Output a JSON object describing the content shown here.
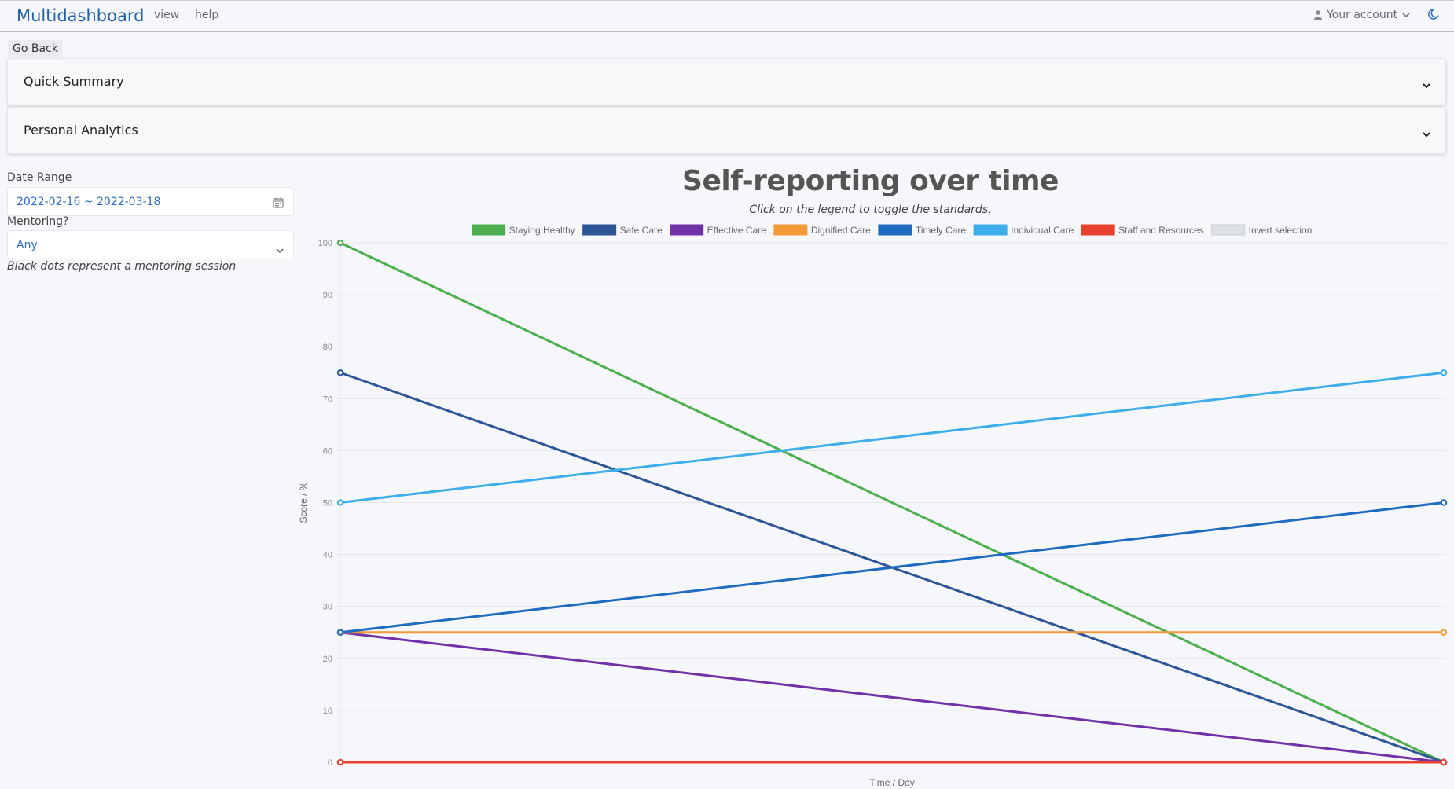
{
  "header": {
    "brand": "Multidashboard",
    "nav": [
      "view",
      "help"
    ],
    "account_label": "Your account"
  },
  "go_back_label": "Go Back",
  "panels": [
    {
      "title": "Quick Summary"
    },
    {
      "title": "Personal Analytics"
    }
  ],
  "filters": {
    "date_range_label": "Date Range",
    "date_range_value": "2022-02-16 ~ 2022-03-18",
    "mentoring_label": "Mentoring?",
    "mentoring_value": "Any",
    "note": "Black dots represent a mentoring session"
  },
  "colors": {
    "brand": "#2363a8",
    "link": "#2a6fc4"
  },
  "icons": [
    "user-icon",
    "chevron-down-icon",
    "moon-icon",
    "calendar-icon"
  ],
  "chart_data": {
    "type": "line",
    "title": "Self-reporting over time",
    "subtitle": "Click on the legend to toggle the standards.",
    "xlabel": "Time / Day",
    "ylabel": "Score / %",
    "ylim": [
      0,
      100
    ],
    "yticks": [
      0,
      10,
      20,
      30,
      40,
      50,
      60,
      70,
      80,
      90,
      100
    ],
    "x_points": 2,
    "grid": true,
    "legend_position": "top",
    "series": [
      {
        "name": "Staying Healthy",
        "color": "#4cae4f",
        "values": [
          100,
          0
        ]
      },
      {
        "name": "Safe Care",
        "color": "#2e5596",
        "values": [
          75,
          0
        ]
      },
      {
        "name": "Effective Care",
        "color": "#7132a8",
        "values": [
          25,
          0
        ]
      },
      {
        "name": "Dignified Care",
        "color": "#f29a38",
        "values": [
          25,
          25
        ]
      },
      {
        "name": "Timely Care",
        "color": "#1f6bbf",
        "values": [
          25,
          50
        ]
      },
      {
        "name": "Individual Care",
        "color": "#3daee9",
        "values": [
          50,
          75
        ]
      },
      {
        "name": "Staff and Resources",
        "color": "#e8412e",
        "values": [
          0,
          0
        ]
      }
    ],
    "extra_legend": {
      "name": "Invert selection",
      "color": "#dde1e6"
    }
  }
}
